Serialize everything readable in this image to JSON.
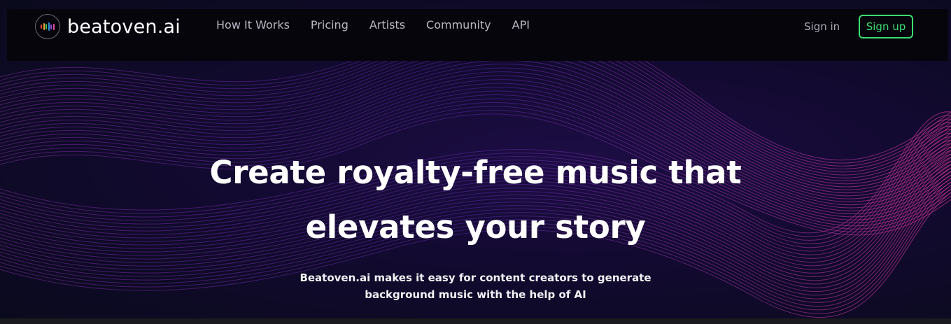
{
  "brand": {
    "name": "beatoven.ai",
    "logo_icon": "equalizer-bars-logo-icon"
  },
  "nav": {
    "links": [
      {
        "label": "How It Works"
      },
      {
        "label": "Pricing"
      },
      {
        "label": "Artists"
      },
      {
        "label": "Community"
      },
      {
        "label": "API"
      }
    ],
    "sign_in": "Sign in",
    "sign_up": "Sign up"
  },
  "hero": {
    "headline_line1": "Create royalty-free music that",
    "headline_line2": "elevates your story",
    "subtitle_line1": "Beatoven.ai makes it easy for content creators to generate",
    "subtitle_line2": "background music with the help of AI"
  },
  "colors": {
    "accent_green": "#3ddc70",
    "wave_purple": "#a02fc8",
    "background": "#120a30"
  }
}
